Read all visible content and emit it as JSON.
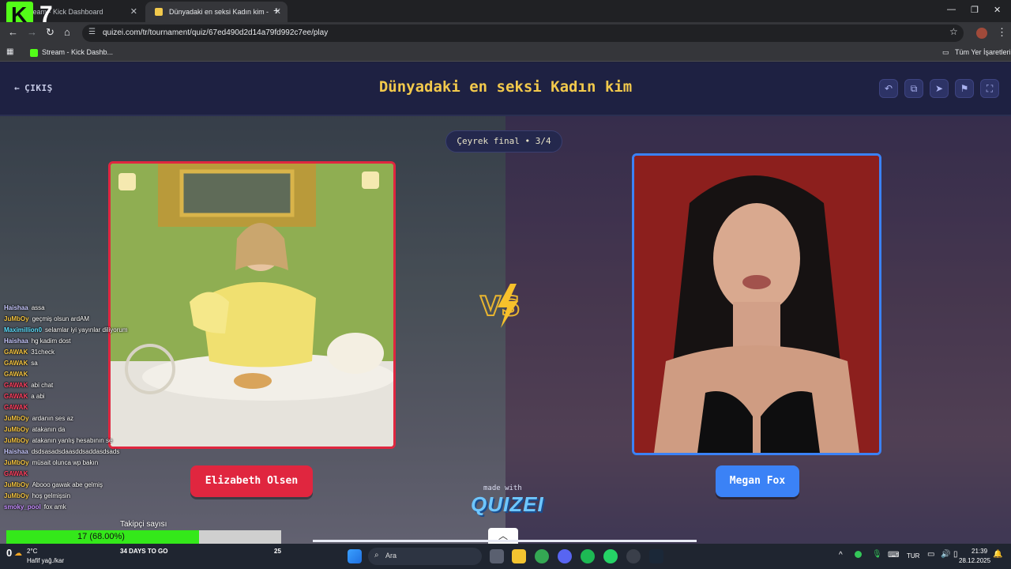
{
  "browser": {
    "tabs": [
      {
        "label": "Stream - Kick Dashboard",
        "active": false
      },
      {
        "label": "Dünyadaki en seksi Kadın kim -",
        "active": true
      }
    ],
    "url": "quizei.com/tr/tournament/quiz/67ed490d2d14a79fd992c7ee/play",
    "bookmarks": {
      "item": "Stream - Kick Dashb...",
      "all": "Tüm Yer İşaretleri"
    }
  },
  "overlay": {
    "kick_counter": "7"
  },
  "page": {
    "exit_label": "ÇIKIŞ",
    "title": "Dünyadaki en seksi Kadın kim",
    "round": "Çeyrek final • 3/4",
    "left_name": "Elizabeth Olsen",
    "right_name": "Megan Fox",
    "made_with": "made with",
    "logo": "QUIZEI",
    "colors": {
      "title": "#f2c94c",
      "left": "#e0263f",
      "right": "#3b82f6"
    }
  },
  "chat": [
    {
      "user": "Haishaa",
      "msg": "assa",
      "color": "#c9c9ff"
    },
    {
      "user": "JuMbOy",
      "msg": "geçmiş olsun ardAM",
      "color": "#f5c542"
    },
    {
      "user": "Maximillion0",
      "msg": "selamlar iyi yayınlar diliyorum",
      "color": "#5ce0ff"
    },
    {
      "user": "Haishaa",
      "msg": "hg kadim dost",
      "color": "#c9c9ff"
    },
    {
      "user": "GAWAK",
      "msg": "31check",
      "color": "#f5c542"
    },
    {
      "user": "GAWAK",
      "msg": "sa",
      "color": "#f5c542"
    },
    {
      "user": "GAWAK",
      "msg": "",
      "color": "#f5c542"
    },
    {
      "user": "GAWAK",
      "msg": "abi chat",
      "color": "#ff4060"
    },
    {
      "user": "GAWAK",
      "msg": "a abi",
      "color": "#ff4060"
    },
    {
      "user": "GAWAK",
      "msg": "",
      "color": "#ff4060"
    },
    {
      "user": "JuMbOy",
      "msg": "ardanın ses az",
      "color": "#f5c542"
    },
    {
      "user": "JuMbOy",
      "msg": "atakanın da",
      "color": "#f5c542"
    },
    {
      "user": "JuMbOy",
      "msg": "atakanın yanlış hesabının se",
      "color": "#f5c542"
    },
    {
      "user": "Haishaa",
      "msg": "dsdsasadsdaasddsaddasdsads",
      "color": "#c9c9ff"
    },
    {
      "user": "JuMbOy",
      "msg": "müsait olunca wp bakın",
      "color": "#f5c542"
    },
    {
      "user": "GAWAK",
      "msg": "",
      "color": "#ff4060"
    },
    {
      "user": "JuMbOy",
      "msg": "Abooo gawak abe gelmiş",
      "color": "#f5c542"
    },
    {
      "user": "JuMbOy",
      "msg": "hoş gelmişsin",
      "color": "#f5c542"
    },
    {
      "user": "smoky_pool",
      "msg": "fox amk",
      "color": "#c58cff"
    }
  ],
  "goal": {
    "title": "Takipçi sayısı",
    "text": "17 (68.00%)",
    "progress": 0.68
  },
  "taskbar": {
    "weather_temp": "2°C",
    "weather_desc": "Hafif yağ./kar",
    "days_to_go": "34 DAYS TO GO",
    "counter": "25",
    "zero": "0",
    "search": "Ara",
    "lang": "TUR",
    "time": "21:39",
    "date": "28.12.2025"
  }
}
